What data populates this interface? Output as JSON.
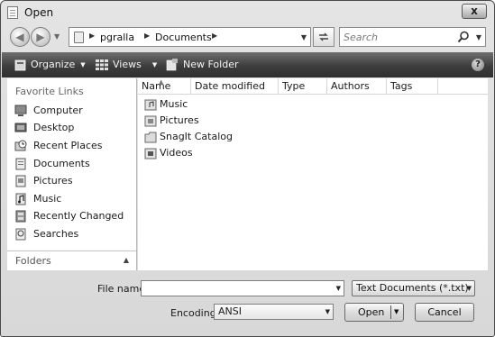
{
  "window": {
    "title": "Open",
    "close_label": "x"
  },
  "address": {
    "breadcrumbs": [
      "pgralla",
      "Documents"
    ],
    "search_placeholder": "Search"
  },
  "toolbar": {
    "organize_label": "Organize",
    "views_label": "Views",
    "new_folder_label": "New Folder",
    "help_label": "?"
  },
  "nav_pane": {
    "heading": "Favorite Links",
    "items": [
      {
        "label": "Computer",
        "icon": "computer-icon"
      },
      {
        "label": "Desktop",
        "icon": "desktop-icon"
      },
      {
        "label": "Recent Places",
        "icon": "recent-places-icon"
      },
      {
        "label": "Documents",
        "icon": "documents-icon"
      },
      {
        "label": "Pictures",
        "icon": "pictures-icon"
      },
      {
        "label": "Music",
        "icon": "music-icon"
      },
      {
        "label": "Recently Changed",
        "icon": "recently-changed-icon"
      },
      {
        "label": "Searches",
        "icon": "searches-icon"
      }
    ],
    "folders_label": "Folders"
  },
  "file_list": {
    "columns": [
      "Name",
      "Date modified",
      "Type",
      "Authors",
      "Tags"
    ],
    "items": [
      {
        "name": "Music",
        "icon": "music-folder-icon"
      },
      {
        "name": "Pictures",
        "icon": "pictures-folder-icon"
      },
      {
        "name": "SnagIt Catalog",
        "icon": "folder-icon"
      },
      {
        "name": "Videos",
        "icon": "videos-folder-icon"
      }
    ]
  },
  "bottom": {
    "file_name_label": "File name:",
    "file_name_value": "",
    "file_type_value": "Text Documents (*.txt)",
    "encoding_label": "Encoding:",
    "encoding_value": "ANSI",
    "open_label": "Open",
    "cancel_label": "Cancel"
  }
}
